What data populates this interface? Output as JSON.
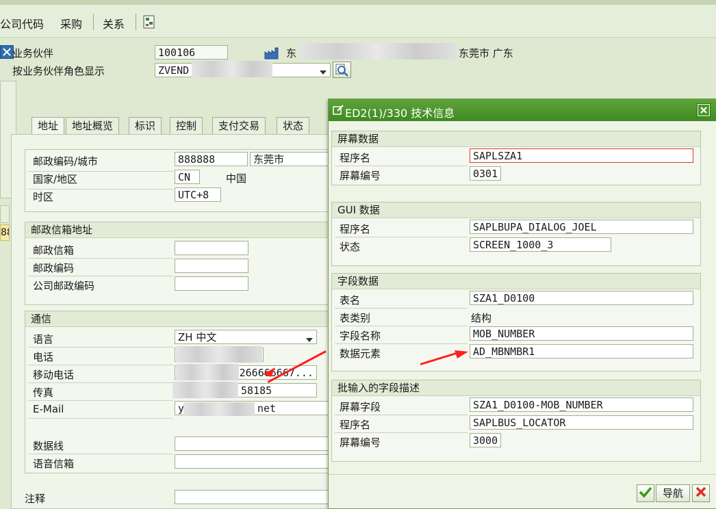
{
  "toolbar": {
    "menu": [
      "公司代码",
      "采购",
      "关系"
    ]
  },
  "header": {
    "bp_label": "业务伙伴",
    "bp_value": "100106",
    "bp_addr_prefix": "东",
    "bp_addr_suffix": "东莞市 广东",
    "role_label": "按业务伙伴角色显示",
    "role_value": "ZVEND"
  },
  "left_edge_text": "88",
  "tabs": [
    "地址",
    "地址概览",
    "标识",
    "控制",
    "支付交易",
    "状态"
  ],
  "address": {
    "postal_city_label": "邮政编码/城市",
    "postal_code": "888888",
    "city": "东莞市",
    "country_label": "国家/地区",
    "country_code": "CN",
    "country_name": "中国",
    "timezone_label": "时区",
    "timezone": "UTC+8"
  },
  "pobox": {
    "title": "邮政信箱地址",
    "box_label": "邮政信箱",
    "postal_label": "邮政编码",
    "company_postal_label": "公司邮政编码"
  },
  "comm": {
    "title": "通信",
    "lang_label": "语言",
    "lang_value": "ZH 中文",
    "phone_label": "电话",
    "mobile_label": "移动电话",
    "mobile_value": "6266666667...",
    "fax_label": "传真",
    "fax_value": "58185",
    "email_label": "E-Mail",
    "email_prefix": "y",
    "email_suffix": "net",
    "dataline_label": "数据线",
    "voicemail_label": "语音信箱"
  },
  "notes_label": "注释",
  "dialog": {
    "title": "ED2(1)/330 技术信息",
    "screen": {
      "title": "屏幕数据",
      "prog_label": "程序名",
      "prog_value": "SAPLSZA1",
      "num_label": "屏幕编号",
      "num_value": "0301"
    },
    "gui": {
      "title": "GUI 数据",
      "prog_label": "程序名",
      "prog_value": "SAPLBUPA_DIALOG_JOEL",
      "status_label": "状态",
      "status_value": "SCREEN_1000_3"
    },
    "field": {
      "title": "字段数据",
      "table_label": "表名",
      "table_value": "SZA1_D0100",
      "tabtype_label": "表类别",
      "tabtype_value": "结构",
      "fname_label": "字段名称",
      "fname_value": "MOB_NUMBER",
      "elem_label": "数据元素",
      "elem_value": "AD_MBNMBR1"
    },
    "batch": {
      "title": "批输入的字段描述",
      "sfield_label": "屏幕字段",
      "sfield_value": "SZA1_D0100-MOB_NUMBER",
      "prog_label": "程序名",
      "prog_value": "SAPLBUS_LOCATOR",
      "num_label": "屏幕编号",
      "num_value": "3000"
    },
    "nav_label": "导航"
  },
  "colors": {
    "title_green": "#4a9a2a",
    "arrow_red": "#ff1f1f",
    "cancel_red": "#e03020"
  }
}
